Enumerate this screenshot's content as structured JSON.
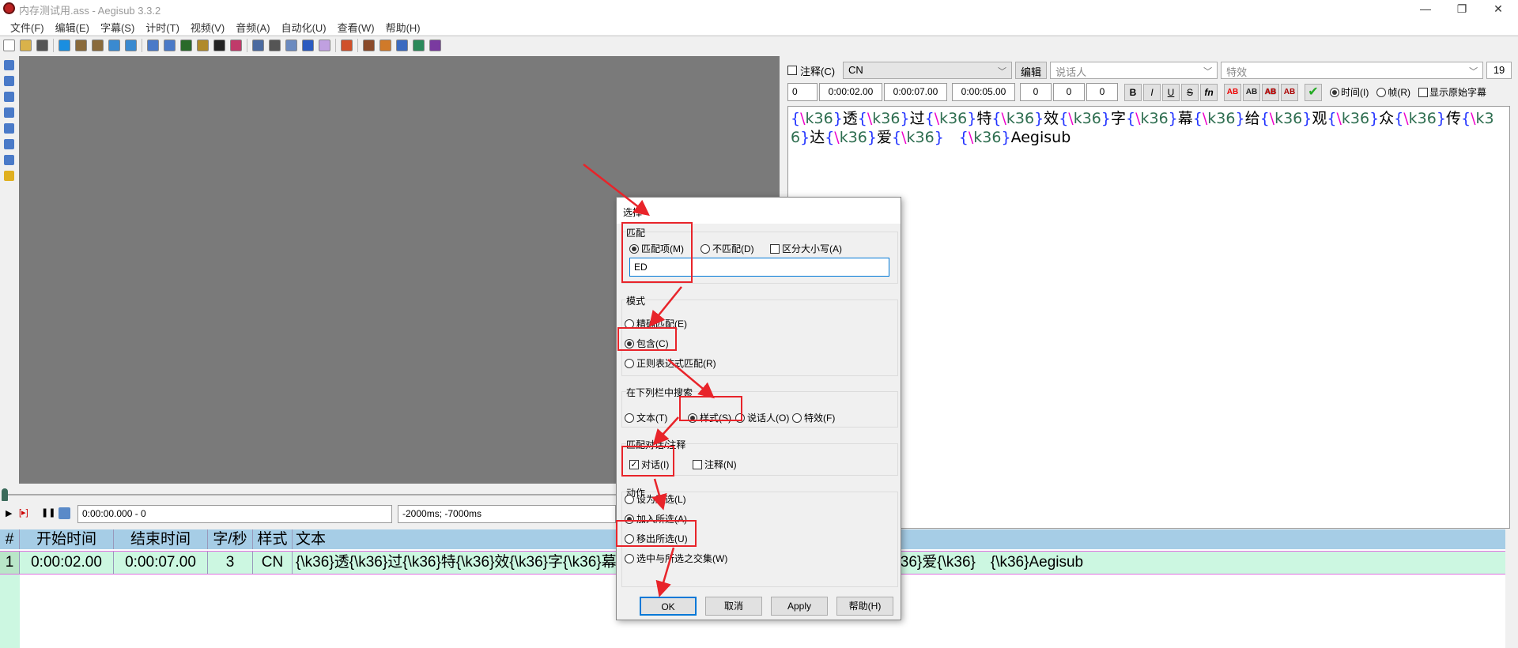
{
  "window": {
    "title": "内存测试用.ass - Aegisub 3.3.2",
    "controls": [
      "—",
      "❐",
      "✕"
    ]
  },
  "menu": [
    "文件(F)",
    "编辑(E)",
    "字幕(S)",
    "计时(T)",
    "视频(V)",
    "音频(A)",
    "自动化(U)",
    "查看(W)",
    "帮助(H)"
  ],
  "toolbar_icons": [
    "new-file",
    "open-file",
    "save-file",
    "jump-to",
    "zoom-in",
    "zoom-out",
    "snap-start",
    "snap-end",
    "style-manager",
    "properties",
    "attachments",
    "fonts-collector",
    "translation",
    "resample",
    "spell-check",
    "timing-postprocessor",
    "kanji-timer",
    "select-lines",
    "sort",
    "assistant",
    "options",
    "shift-times",
    "karaoke",
    "automation",
    "macro"
  ],
  "editor": {
    "comment_label": "注释(C)",
    "style": "CN",
    "edit_label": "编辑",
    "actor_placeholder": "说话人",
    "effect_placeholder": "特效",
    "char_count": "19",
    "layer": "0",
    "start": "0:00:02.00",
    "end": "0:00:07.00",
    "duration": "0:00:05.00",
    "margin_l": "0",
    "margin_r": "0",
    "margin_v": "0",
    "format_buttons": [
      "B",
      "I",
      "U",
      "S",
      "fn"
    ],
    "color_buttons": [
      "AB",
      "AB",
      "AB",
      "AB"
    ],
    "time_label": "时间(I)",
    "frame_label": "帧(R)",
    "show_original_label": "显示原始字幕",
    "text": "{\\k36}透{\\k36}过{\\k36}特{\\k36}效{\\k36}字{\\k36}幕{\\k36}给{\\k36}观{\\k36}众{\\k36}传{\\k36}达{\\k36}爱{\\k36}　{\\k36}Aegisub"
  },
  "audio": {
    "position": "0:00:00.000 - 0",
    "offset": "-2000ms; -7000ms"
  },
  "grid": {
    "headers": [
      "#",
      "开始时间",
      "结束时间",
      "字/秒",
      "样式",
      "文本"
    ],
    "rows": [
      {
        "num": "1",
        "start": "0:00:02.00",
        "end": "0:00:07.00",
        "cps": "3",
        "style": "CN",
        "text": "{\\k36}透{\\k36}过{\\k36}特{\\k36}效{\\k36}字{\\k36}幕{\\k36}给{\\k36}观{\\k36}众{\\k36}传{\\k36}达{\\k36}爱{\\k36}　{\\k36}Aegisub"
      }
    ]
  },
  "dialog": {
    "title": "选择",
    "match": {
      "label": "匹配",
      "match_label": "匹配项(M)",
      "nomatch_label": "不匹配(D)",
      "case_label": "区分大小写(A)",
      "value": "ED"
    },
    "mode": {
      "label": "模式",
      "options": [
        "精确匹配(E)",
        "包含(C)",
        "正则表达式匹配(R)"
      ],
      "selected": 1
    },
    "field": {
      "label": "在下列栏中搜索",
      "options": [
        "文本(T)",
        "样式(S)",
        "说话人(O)",
        "特效(F)"
      ],
      "selected": 1
    },
    "type": {
      "label": "匹配对话/注释",
      "dialogue_label": "对话(I)",
      "dialogue_checked": true,
      "comment_label": "注释(N)",
      "comment_checked": false
    },
    "action": {
      "label": "动作",
      "options": [
        "设为所选(L)",
        "加入所选(A)",
        "移出所选(U)",
        "选中与所选之交集(W)"
      ],
      "selected": 1
    },
    "buttons": {
      "ok": "OK",
      "cancel": "取消",
      "apply": "Apply",
      "help": "帮助(H)"
    }
  },
  "colors": {
    "annotation": "#e8242a",
    "grid_header": "#a6cde6",
    "grid_row": "#ccf7e1",
    "video_bg": "#7a7a7a"
  }
}
